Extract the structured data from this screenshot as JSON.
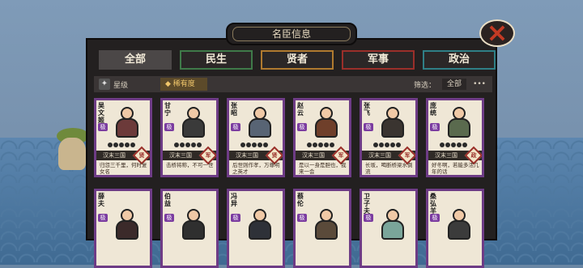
{
  "window": {
    "title": "名臣信息"
  },
  "tabs": [
    {
      "label": "全部",
      "active": true
    },
    {
      "label": "民生"
    },
    {
      "label": "贤者"
    },
    {
      "label": "军事"
    },
    {
      "label": "政治"
    }
  ],
  "filters": {
    "star_label": "星级",
    "rarity_label": "稀有度",
    "filter_label": "筛选：",
    "filter_value": "全部",
    "more_label": "•••"
  },
  "cards_row1": [
    {
      "name": "吴文姬",
      "grade": "极",
      "dynasty": "汉末三国",
      "type": "贤",
      "desc": "归怨三千里，何时复女名"
    },
    {
      "name": "甘宁",
      "grade": "极",
      "dynasty": "汉末三国",
      "type": "军",
      "desc": "击桥将称，不可一世"
    },
    {
      "name": "张昭",
      "grade": "极",
      "dynasty": "汉末三国",
      "type": "贤",
      "desc": "后世则作孝，万尊明之英才"
    },
    {
      "name": "赵云",
      "grade": "极",
      "dynasty": "汉末三国",
      "type": "军",
      "desc": "是以一身是胆也，我来一会"
    },
    {
      "name": "张飞",
      "grade": "极",
      "dynasty": "汉末三国",
      "type": "军",
      "desc": "长坂，喝断桥梁水倒流"
    },
    {
      "name": "庞统",
      "grade": "极",
      "dynasty": "汉末三国",
      "type": "政",
      "desc": "好冬啊，若能多活几年的话"
    }
  ],
  "cards_row2": [
    {
      "name": "薛夫",
      "grade": "极"
    },
    {
      "name": "伯益",
      "grade": "极"
    },
    {
      "name": "冯异",
      "grade": "极"
    },
    {
      "name": "蔡伦",
      "grade": "极"
    },
    {
      "name": "卫子夫",
      "grade": "极"
    },
    {
      "name": "桑弘羊",
      "grade": "极"
    }
  ],
  "close_icon": "close-icon"
}
